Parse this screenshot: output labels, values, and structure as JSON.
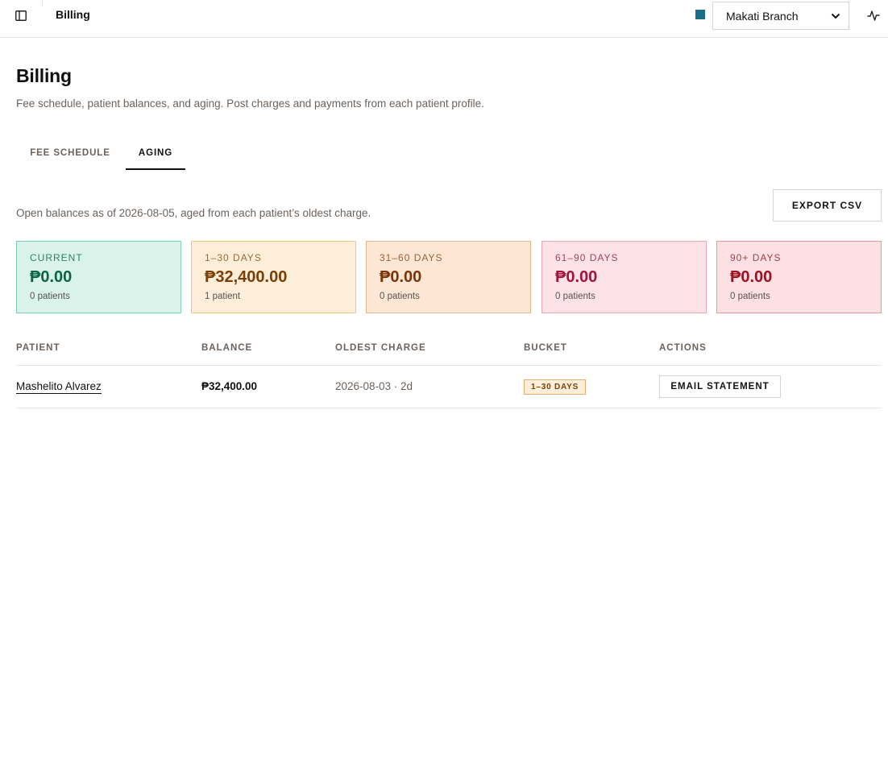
{
  "topbar": {
    "title": "Billing",
    "branch_color": "#1a6e8a",
    "branch_selected": "Makati Branch",
    "icons": [
      "sidebar-toggle-icon",
      "chevron-down-icon",
      "activity-icon"
    ]
  },
  "header": {
    "title": "Billing",
    "subtitle": "Fee schedule, patient balances, and aging. Post charges and payments from each patient profile."
  },
  "tabs": [
    {
      "label": "FEE SCHEDULE",
      "active": false
    },
    {
      "label": "AGING",
      "active": true
    }
  ],
  "aging": {
    "as_of_text": "Open balances as of 2026-08-05, aged from each patient’s oldest charge.",
    "export_label": "EXPORT CSV",
    "buckets": [
      {
        "label": "CURRENT",
        "amount": "₱0.00",
        "count": "0 patients"
      },
      {
        "label": "1–30 DAYS",
        "amount": "₱32,400.00",
        "count": "1 patient"
      },
      {
        "label": "31–60 DAYS",
        "amount": "₱0.00",
        "count": "0 patients"
      },
      {
        "label": "61–90 DAYS",
        "amount": "₱0.00",
        "count": "0 patients"
      },
      {
        "label": "90+ DAYS",
        "amount": "₱0.00",
        "count": "0 patients"
      }
    ],
    "table": {
      "columns": [
        "PATIENT",
        "BALANCE",
        "OLDEST CHARGE",
        "BUCKET",
        "ACTIONS"
      ],
      "rows": [
        {
          "patient": "Mashelito Alvarez",
          "balance": "₱32,400.00",
          "oldest_charge": "2026-08-03 · 2d",
          "bucket": "1–30 DAYS",
          "action": "EMAIL STATEMENT"
        }
      ]
    }
  }
}
